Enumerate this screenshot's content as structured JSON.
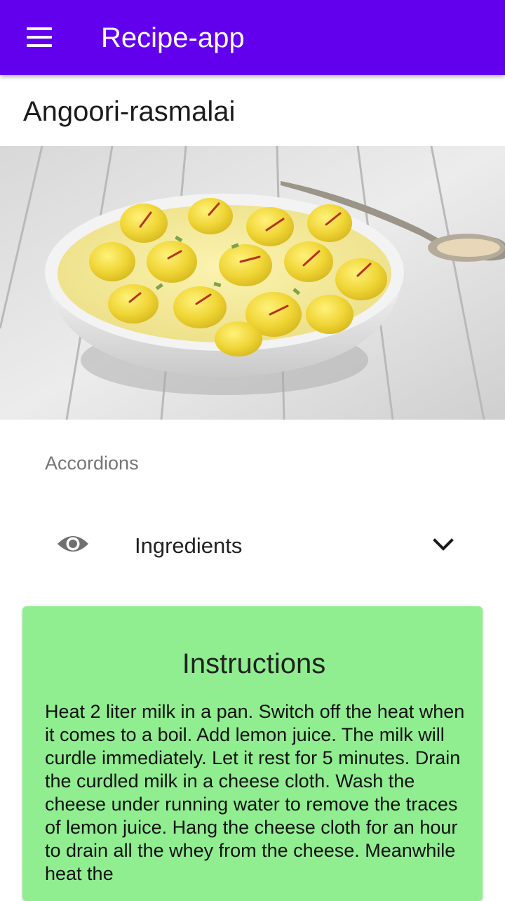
{
  "app_bar": {
    "title": "Recipe-app",
    "menu_icon": "hamburger-menu-icon",
    "background": "#6200ee"
  },
  "recipe": {
    "title": "Angoori-rasmalai",
    "image_alt": "Angoori rasmalai in a white bowl"
  },
  "accordions": {
    "section_label": "Accordions",
    "items": [
      {
        "label": "Ingredients",
        "leading_icon": "eye-icon",
        "trailing_icon": "chevron-down-icon",
        "expanded": false
      }
    ]
  },
  "instructions": {
    "title": "Instructions",
    "text": "Heat 2 liter milk in a pan. Switch off the heat when it comes to a boil. Add lemon juice. The milk will curdle immediately. Let it rest for 5 minutes. Drain the curdled milk in a cheese cloth. Wash the cheese under running water to remove the traces of lemon juice. Hang the cheese cloth for an hour to drain all the whey from the cheese. Meanwhile heat the",
    "background": "#90ee90"
  }
}
